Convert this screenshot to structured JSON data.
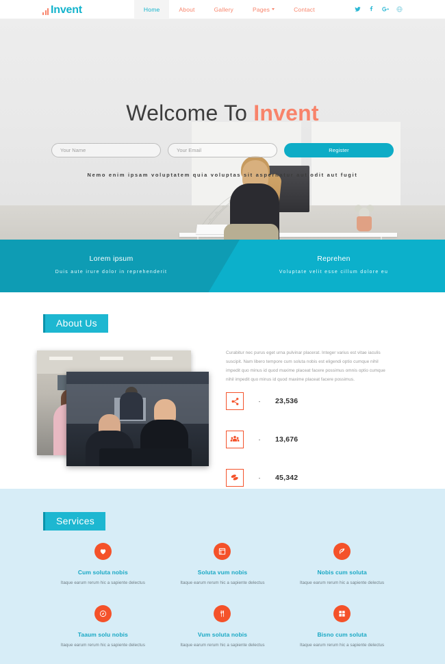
{
  "navbar": {
    "brand": "Invent",
    "brand_icon": "bar-chart-icon",
    "links": [
      {
        "label": "Home",
        "active": true
      },
      {
        "label": "About",
        "active": false
      },
      {
        "label": "Gallery",
        "active": false
      },
      {
        "label": "Pages",
        "active": false,
        "has_caret": true
      },
      {
        "label": "Contact",
        "active": false
      }
    ],
    "socials": [
      {
        "name": "twitter-icon"
      },
      {
        "name": "facebook-icon"
      },
      {
        "name": "google-plus-icon"
      },
      {
        "name": "globe-icon"
      }
    ]
  },
  "hero": {
    "title_prefix": "Welcome To ",
    "title_highlight": "Invent",
    "name_placeholder": "Your Name",
    "name_value": "",
    "email_placeholder": "Your Email",
    "email_value": "",
    "register_label": "Register",
    "subtitle": "Nemo enim ipsam voluptatem quia voluptas sit aspernatur aut odit aut fugit"
  },
  "banner": {
    "columns": [
      {
        "title": "Lorem ipsum",
        "text": "Duis aute irure dolor in reprehenderit"
      },
      {
        "title": "Reprehen",
        "text": "Voluptate velit esse cillum dolore eu"
      }
    ]
  },
  "about": {
    "badge": "About Us",
    "paragraph": "Curabitur nec purus eget urna pulvinar placerat. Integer varius est vitae iaculis suscipit. Nam libero tempore cum soluta nobis est eligendi optio cumque nihil impedit quo minus id quod maxime placeat facere possimus omnis optio cumque nihil impedit quo minus id quod maxime placeat facere possimus.",
    "counters": [
      {
        "icon": "share-nodes-icon",
        "dash": "-",
        "value": "23,536"
      },
      {
        "icon": "users-group-icon",
        "dash": "-",
        "value": "13,676"
      },
      {
        "icon": "coins-icon",
        "dash": "-",
        "value": "45,342"
      }
    ]
  },
  "services": {
    "badge": "Services",
    "items": [
      {
        "icon": "heart-icon",
        "title": "Cum soluta nobis",
        "desc": "Itaque earum rerum hic a sapiente delectus"
      },
      {
        "icon": "window-icon",
        "title": "Soluta vum nobis",
        "desc": "Itaque earum rerum hic a sapiente delectus"
      },
      {
        "icon": "leaf-icon",
        "title": "Nobis cum soluta",
        "desc": "Itaque earum rerum hic a sapiente delectus"
      },
      {
        "icon": "compass-icon",
        "title": "Taaum solu nobis",
        "desc": "Itaque earum rerum hic a sapiente delectus"
      },
      {
        "icon": "cutlery-icon",
        "title": "Vum soluta nobis",
        "desc": "Itaque earum rerum hic a sapiente delectus"
      },
      {
        "icon": "grid-icon",
        "title": "Bisno cum soluta",
        "desc": "Itaque earum rerum hic a sapiente delectus"
      }
    ]
  },
  "colors": {
    "teal": "#13b3cc",
    "teal_dark": "#0e9cb4",
    "coral": "#f8836a",
    "orange": "#f4522a",
    "hero_bg": "#eeeeee",
    "services_bg": "#d7edf7"
  }
}
